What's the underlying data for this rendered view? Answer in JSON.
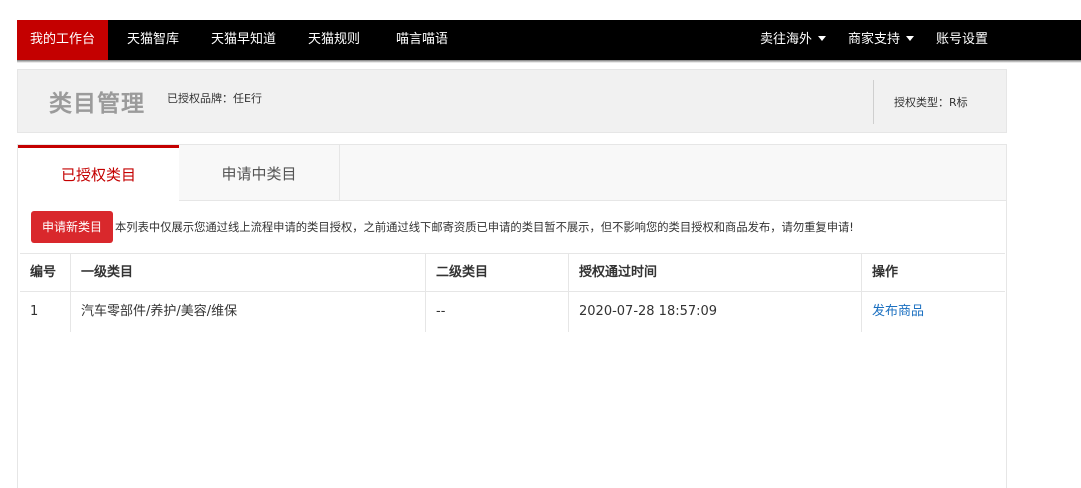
{
  "topbar": {
    "left_items": [
      "我的工作台",
      "天猫智库",
      "天猫早知道",
      "天猫规则",
      "喵言喵语"
    ],
    "right_items": [
      "卖往海外",
      "商家支持",
      "账号设置"
    ]
  },
  "header": {
    "title": "类目管理",
    "brand_label": "已授权品牌：任E行",
    "auth_type": "授权类型：R标"
  },
  "tabs": [
    "已授权类目",
    "申请中类目"
  ],
  "toolbar": {
    "apply_label": "申请新类目",
    "notice": "本列表中仅展示您通过线上流程申请的类目授权，之前通过线下邮寄资质已申请的类目暂不展示，但不影响您的类目授权和商品发布，请勿重复申请!"
  },
  "table": {
    "columns": [
      "编号",
      "一级类目",
      "二级类目",
      "授权通过时间",
      "操作"
    ],
    "rows": [
      {
        "id": "1",
        "level1": "汽车零部件/养护/美容/维保",
        "level2": "--",
        "time": "2020-07-28 18:57:09",
        "action": "发布商品"
      }
    ]
  }
}
